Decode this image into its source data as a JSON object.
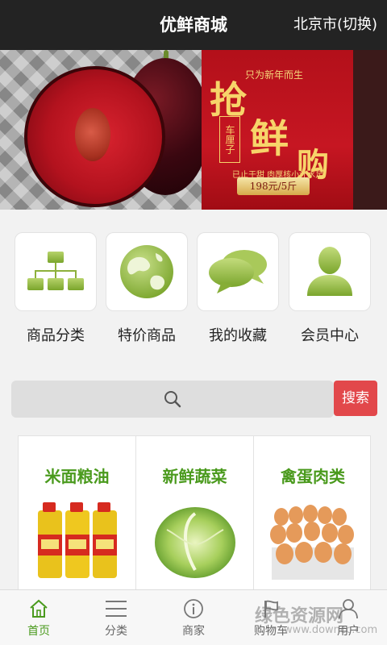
{
  "header": {
    "title": "优鲜商城",
    "city": "北京市(切换)"
  },
  "banner": {
    "small_text": "只为新年而生",
    "headline_1": "抢",
    "headline_2": "鲜",
    "headline_3": "购",
    "tag": "车厘子",
    "desc": "已止于甜 肉厚核小汁水足",
    "price": "198元/5斤",
    "slides_total": 2,
    "active_slide": 1
  },
  "grid": {
    "items": [
      {
        "label": "商品分类",
        "icon": "sitemap-icon"
      },
      {
        "label": "特价商品",
        "icon": "globe-icon"
      },
      {
        "label": "我的收藏",
        "icon": "chat-bubbles-icon"
      },
      {
        "label": "会员中心",
        "icon": "user-icon"
      }
    ]
  },
  "search": {
    "placeholder": "",
    "button_label": "搜索"
  },
  "cards": [
    {
      "title": "米面粮油"
    },
    {
      "title": "新鲜蔬菜"
    },
    {
      "title": "禽蛋肉类"
    }
  ],
  "tabbar": {
    "items": [
      {
        "label": "首页",
        "icon": "home-icon",
        "active": true
      },
      {
        "label": "分类",
        "icon": "menu-icon",
        "active": false
      },
      {
        "label": "商家",
        "icon": "info-icon",
        "active": false
      },
      {
        "label": "购物车",
        "icon": "flag-icon",
        "active": false
      },
      {
        "label": "用户",
        "icon": "user-icon",
        "active": false
      }
    ]
  },
  "watermark": {
    "text": "绿色资源网",
    "url": "www.downcc.com"
  },
  "colors": {
    "accent_green": "#4a9a1d",
    "header_bg": "#232323",
    "search_button": "#e2484b"
  }
}
